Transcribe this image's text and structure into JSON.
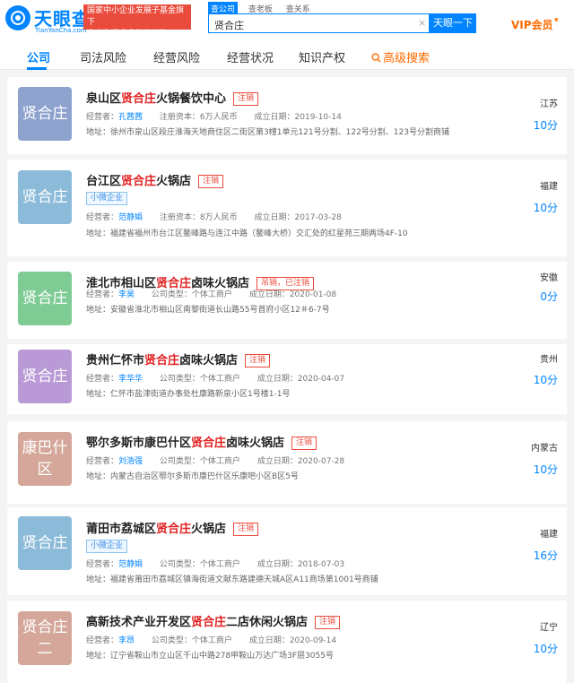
{
  "header": {
    "logo_text": "天眼查",
    "logo_sub": "TianYanCha.com",
    "gov_badge_line1": "国家中小企业发展子基金旗下",
    "gov_badge_line2": "官方备案企业征信机构",
    "search_tabs": [
      "查公司",
      "查老板",
      "查关系"
    ],
    "search_value": "贤合庄",
    "clear_symbol": "×",
    "search_button": "天眼一下",
    "vip_label": "VIP会员",
    "vip_caret": "▾"
  },
  "nav": {
    "tabs": [
      "公司",
      "司法风险",
      "经营风险",
      "经营状况",
      "知识产权"
    ],
    "advanced": "高级搜索"
  },
  "colors": {
    "accent": "#0084ff",
    "status_red": "#e94b3c",
    "highlight": "#e02020",
    "vip_orange": "#ff6a00"
  },
  "results": [
    {
      "avatar": "贤合庄",
      "avatar_color": "#8ea2ce",
      "name_prefix": "泉山区",
      "name_hl": "贤合庄",
      "name_suffix": "火锅餐饮中心",
      "status": "注销",
      "tag": null,
      "f1_label": "经营者：",
      "f1_value": "孔茜茜",
      "f2_label": "注册资本：",
      "f2_value": "6万人民币",
      "f3_label": "成立日期：",
      "f3_value": "2019-10-14",
      "address": "地址：徐州市泉山区段庄淮海天地商住区二街区第3幢1单元121号分割、122号分割、123号分割商铺",
      "region": "江苏",
      "score": "10分"
    },
    {
      "avatar": "贤合庄",
      "avatar_color": "#8bbbd9",
      "name_prefix": "台江区",
      "name_hl": "贤合庄",
      "name_suffix": "火锅店",
      "status": "注销",
      "tag": "小微企业",
      "f1_label": "经营者：",
      "f1_value": "范静娟",
      "f2_label": "注册资本：",
      "f2_value": "8万人民币",
      "f3_label": "成立日期：",
      "f3_value": "2017-03-28",
      "address": "地址：福建省福州市台江区鳌峰路与连江中路（鳌峰大桥）交汇处的红星苑三期两场4F-10",
      "region": "福建",
      "score": "10分"
    },
    {
      "avatar": "贤合庄",
      "avatar_color": "#7ecb94",
      "name_prefix": "淮北市相山区",
      "name_hl": "贤合庄",
      "name_suffix": "卤味火锅店",
      "status": "吊销，已注销",
      "tag": null,
      "f1_label": "经营者：",
      "f1_value": "李昊",
      "f2_label": "公司类型：",
      "f2_value": "个体工商户",
      "f3_label": "成立日期：",
      "f3_value": "2020-01-08",
      "address": "地址：安徽省淮北市相山区南黎街道长山路55号首府小区12＃6-7号",
      "region": "安徽",
      "score": "0分"
    },
    {
      "avatar": "贤合庄",
      "avatar_color": "#b99ad6",
      "name_prefix": "贵州仁怀市",
      "name_hl": "贤合庄",
      "name_suffix": "卤味火锅店",
      "status": "注销",
      "tag": null,
      "f1_label": "经营者：",
      "f1_value": "李华华",
      "f2_label": "公司类型：",
      "f2_value": "个体工商户",
      "f3_label": "成立日期：",
      "f3_value": "2020-04-07",
      "address": "地址：仁怀市盐津街道办事处杜康路新泉小区1号楼1-1号",
      "region": "贵州",
      "score": "10分"
    },
    {
      "avatar": "康巴什区",
      "avatar_color": "#d4a79a",
      "name_prefix": "鄂尔多斯市康巴什区",
      "name_hl": "贤合庄",
      "name_suffix": "卤味火锅店",
      "status": "注销",
      "tag": null,
      "f1_label": "经营者：",
      "f1_value": "刘浩强",
      "f2_label": "公司类型：",
      "f2_value": "个体工商户",
      "f3_label": "成立日期：",
      "f3_value": "2020-07-28",
      "address": "地址：内蒙古自治区鄂尔多斯市康巴什区乐康吧小区B区5号",
      "region": "内蒙古",
      "score": "10分"
    },
    {
      "avatar": "贤合庄",
      "avatar_color": "#8bbbd9",
      "name_prefix": "莆田市荔城区",
      "name_hl": "贤合庄",
      "name_suffix": "火锅店",
      "status": "注销",
      "tag": "小微企业",
      "f1_label": "经营者：",
      "f1_value": "范静娟",
      "f2_label": "公司类型：",
      "f2_value": "个体工商户",
      "f3_label": "成立日期：",
      "f3_value": "2018-07-03",
      "address": "地址：福建省莆田市荔城区镇海街道文献东路建德天城A区A11商场第1001号商铺",
      "region": "福建",
      "score": "16分"
    },
    {
      "avatar": "贤合庄二",
      "avatar_color": "#d4a79a",
      "name_prefix": "高新技术产业开发区",
      "name_hl": "贤合庄",
      "name_suffix": "二店休闲火锅店",
      "status": "注销",
      "tag": null,
      "f1_label": "经营者：",
      "f1_value": "李昂",
      "f2_label": "公司类型：",
      "f2_value": "个体工商户",
      "f3_label": "成立日期：",
      "f3_value": "2020-09-14",
      "address": "地址：辽宁省鞍山市立山区千山中路278甲鞍山万达广场3F层3055号",
      "region": "辽宁",
      "score": "10分"
    }
  ]
}
